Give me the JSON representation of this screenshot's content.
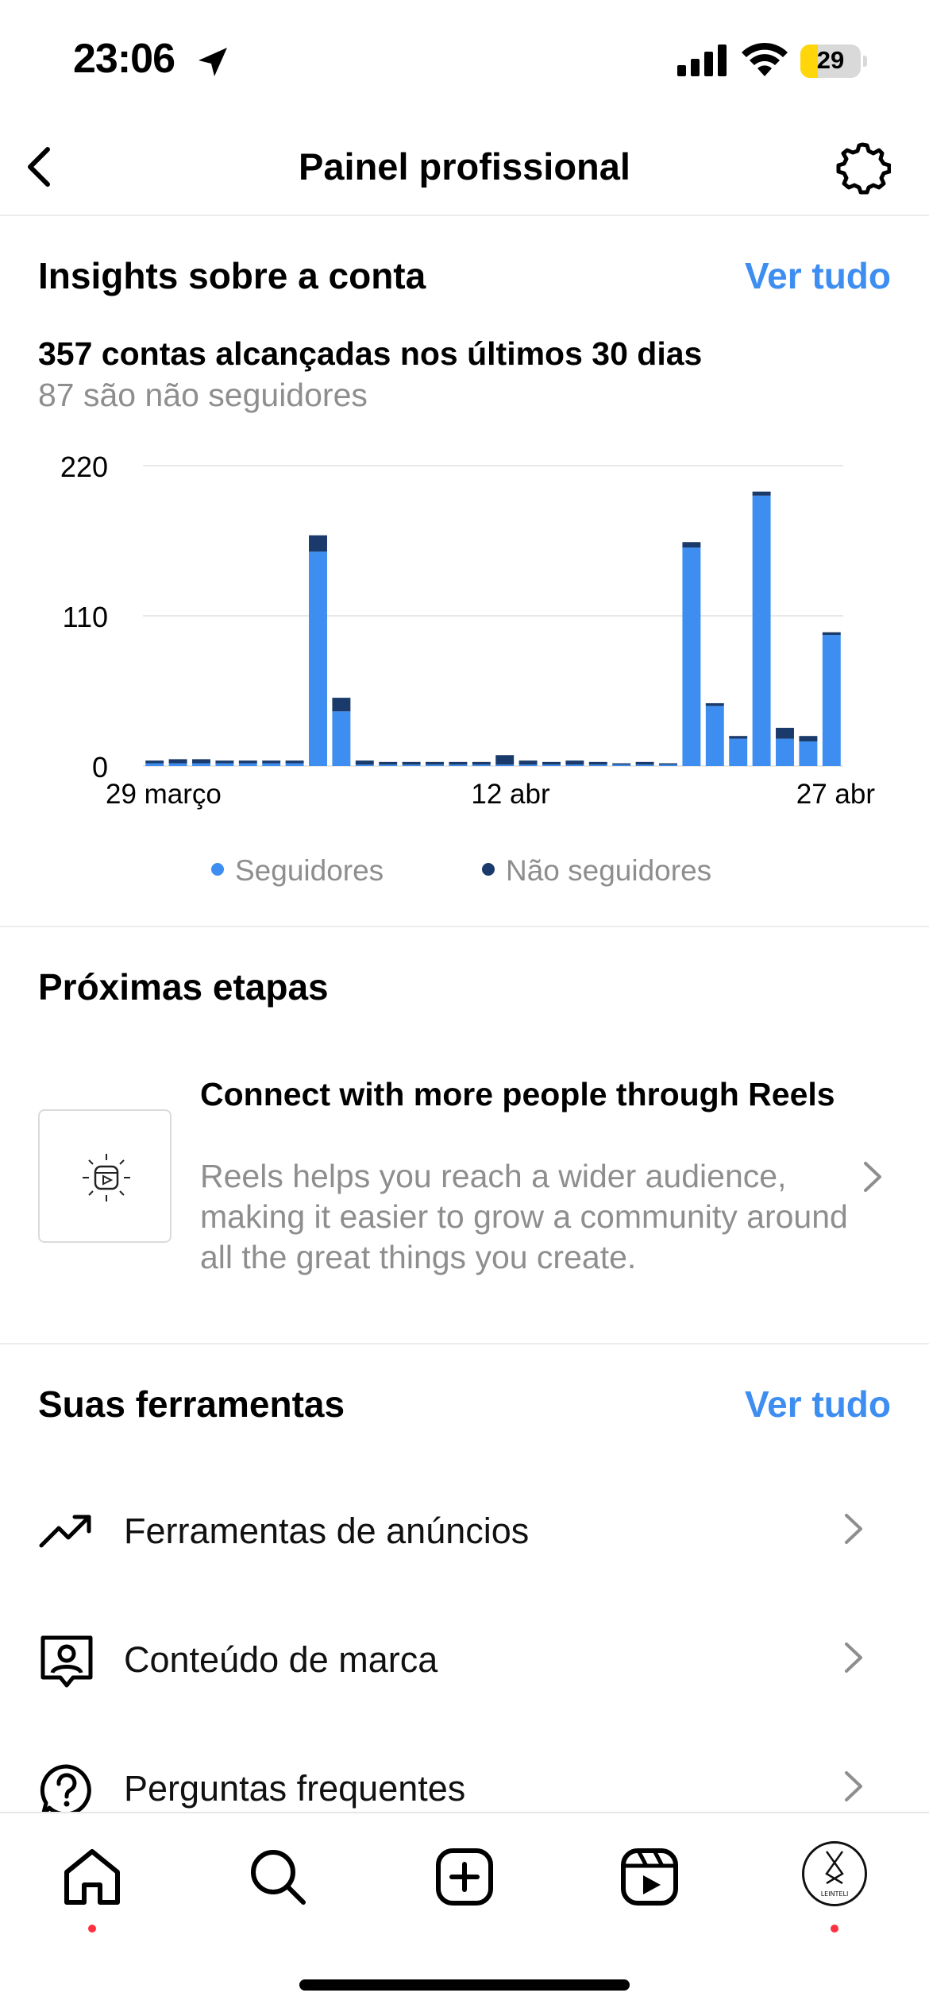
{
  "status": {
    "time": "23:06",
    "battery": "29",
    "battery_level": 0.29
  },
  "header": {
    "title": "Painel profissional"
  },
  "insights": {
    "title": "Insights sobre a conta",
    "see_all": "Ver tudo",
    "reach_main": "357 contas alcançadas nos últimos 30 dias",
    "reach_sub": "87 são não seguidores"
  },
  "chart_data": {
    "type": "bar",
    "stacked": true,
    "y_ticks": [
      "220",
      "110",
      "0"
    ],
    "x_tick_labels": [
      "29 março",
      "12 abr",
      "27 abr"
    ],
    "ylim": [
      0,
      220
    ],
    "grid": true,
    "legend_position": "bottom",
    "series": [
      {
        "name": "Seguidores",
        "color": "#3d8ef0",
        "values": [
          2,
          2,
          2,
          2,
          2,
          2,
          2,
          157,
          40,
          1,
          1,
          1,
          1,
          1,
          1,
          1,
          1,
          1,
          1,
          1,
          1,
          1,
          1,
          160,
          44,
          20,
          198,
          20,
          18,
          96
        ]
      },
      {
        "name": "Não seguidores",
        "color": "#1a3a6b",
        "values": [
          2,
          3,
          3,
          2,
          2,
          2,
          2,
          12,
          10,
          3,
          2,
          2,
          2,
          2,
          2,
          7,
          3,
          2,
          3,
          2,
          1,
          2,
          1,
          4,
          2,
          2,
          3,
          8,
          4,
          2
        ]
      }
    ],
    "legend": [
      "Seguidores",
      "Não seguidores"
    ]
  },
  "next_steps": {
    "title": "Próximas etapas",
    "card_title": "Connect with more people through Reels",
    "card_desc": "Reels helps you reach a wider audience, making it easier to grow a community around all the great things you create."
  },
  "tools": {
    "title": "Suas ferramentas",
    "see_all": "Ver tudo",
    "items": [
      {
        "label": "Ferramentas de anúncios",
        "icon": "trending-up-icon"
      },
      {
        "label": "Conteúdo de marca",
        "icon": "branded-content-icon"
      },
      {
        "label": "Perguntas frequentes",
        "icon": "faq-icon"
      }
    ]
  },
  "nav": {
    "items": [
      "home-icon",
      "search-icon",
      "create-icon",
      "reels-icon",
      "profile-avatar"
    ],
    "avatar_text": "LEINTELI"
  }
}
